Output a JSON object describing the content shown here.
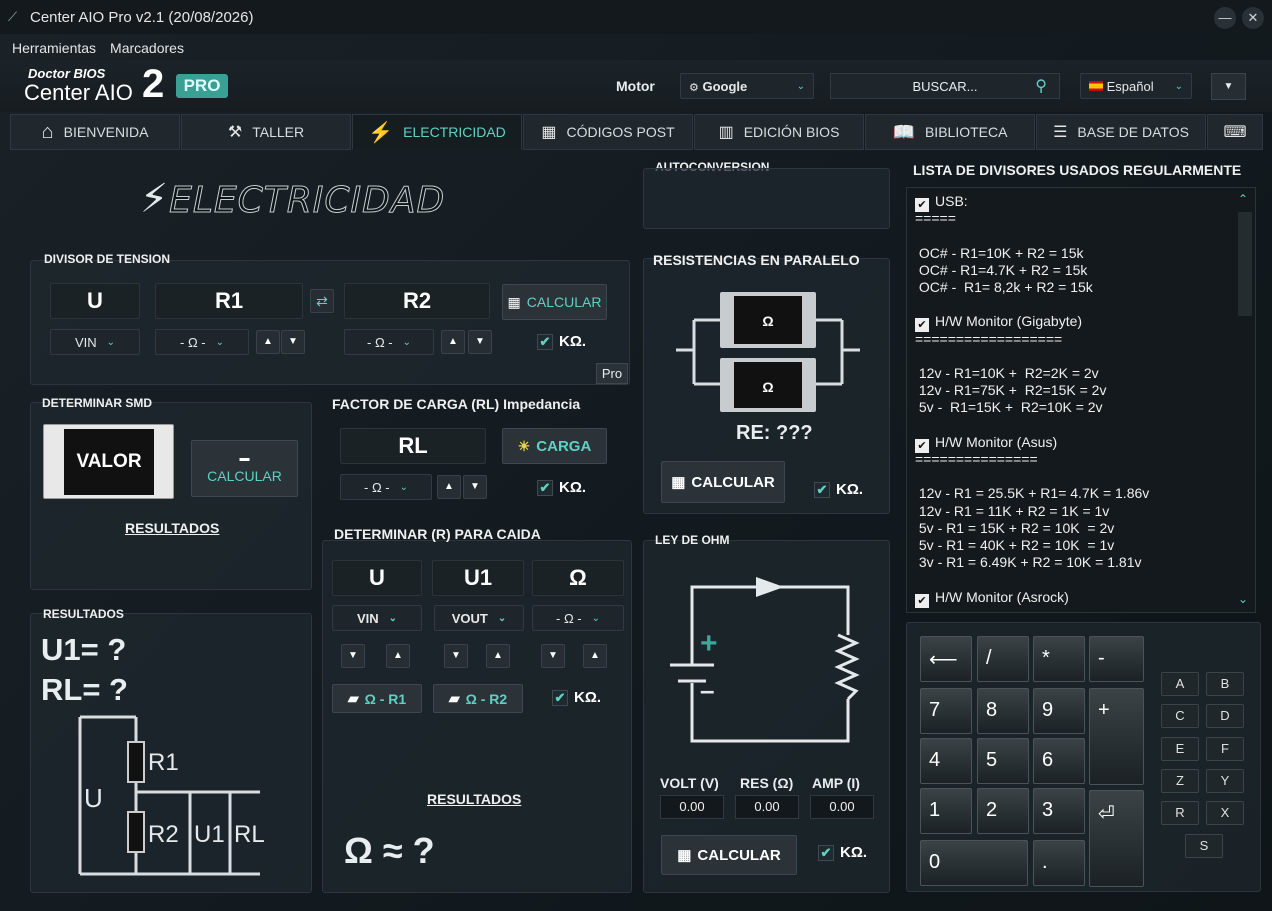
{
  "window": {
    "title": "Center AIO Pro v2.1 (20/08/2026)",
    "minimize": "—",
    "close": "✕"
  },
  "menu": [
    "Herramientas",
    "Marcadores"
  ],
  "logo": {
    "line1": "Doctor BIOS",
    "line2": "Center AIO",
    "number": "2",
    "badge": "PRO"
  },
  "search": {
    "engine_label": "Motor",
    "engine": "Google",
    "placeholder": "BUSCAR...",
    "language": "Español"
  },
  "tabs": [
    {
      "label": "BIENVENIDA",
      "icon": "home-icon"
    },
    {
      "label": "TALLER",
      "icon": "tools-icon"
    },
    {
      "label": "ELECTRICIDAD",
      "icon": "lightning-icon"
    },
    {
      "label": "CÓDIGOS POST",
      "icon": "post-card-icon"
    },
    {
      "label": "EDICIÓN BIOS",
      "icon": "chip-icon"
    },
    {
      "label": "BIBLIOTECA",
      "icon": "book-icon"
    },
    {
      "label": "BASE DE DATOS",
      "icon": "database-icon"
    }
  ],
  "section_banner": "ELECTRICIDAD",
  "divisor": {
    "title": "DIVISOR DE TENSION",
    "u": "U",
    "r1": "R1",
    "r2": "R2",
    "calc": "CALCULAR",
    "vin": "VIN",
    "ohm": "- Ω -",
    "kohm": "KΩ.",
    "pro": "Pro"
  },
  "smd": {
    "title": "DETERMINAR SMD",
    "value": "VALOR",
    "calc": "CALCULAR",
    "results": "RESULTADOS"
  },
  "results_left": {
    "title": "RESULTADOS",
    "u1": "U1= ?",
    "rl": "RL= ?",
    "labels": {
      "u": "U",
      "r1": "R1",
      "r2": "R2",
      "u1": "U1",
      "rl": "RL"
    }
  },
  "carga": {
    "title": "FACTOR DE CARGA (RL) Impedancia",
    "rl": "RL",
    "btn": "CARGA",
    "ohm": "- Ω -",
    "kohm": "KΩ."
  },
  "caida": {
    "title": "DETERMINAR (R) PARA CAIDA",
    "u": "U",
    "u1": "U1",
    "omega": "Ω",
    "vin": "VIN",
    "vout": "VOUT",
    "ohm": "- Ω -",
    "b1": "Ω - R1",
    "b2": "Ω - R2",
    "kohm": "KΩ.",
    "results": "RESULTADOS",
    "answer": "Ω ≈ ?"
  },
  "auto": {
    "title": "AUTOCONVERSION"
  },
  "paralelo": {
    "title": "RESISTENCIAS EN PARALELO",
    "omega": "Ω",
    "re": "RE: ???",
    "calc": "CALCULAR",
    "kohm": "KΩ."
  },
  "ohm": {
    "title": "LEY DE OHM",
    "plus": "+",
    "minus": "–",
    "volt": "VOLT (V)",
    "res": "RES (Ω)",
    "amp": "AMP (I)",
    "volt_val": "0.00",
    "res_val": "0.00",
    "amp_val": "0.00",
    "calc": "CALCULAR",
    "kohm": "KΩ."
  },
  "divisores": {
    "title": "LISTA DE DIVISORES USADOS REGULARMENTE",
    "lines": [
      {
        "t": "USB:",
        "chk": true
      },
      {
        "t": "====="
      },
      {
        "t": ""
      },
      {
        "t": " OC# - R1=10K + R2 = 15k"
      },
      {
        "t": " OC# - R1=4.7K + R2 = 15k"
      },
      {
        "t": " OC# -  R1= 8,2k + R2 = 15k"
      },
      {
        "t": ""
      },
      {
        "t": "H/W Monitor (Gigabyte)",
        "chk": true
      },
      {
        "t": "=================="
      },
      {
        "t": ""
      },
      {
        "t": " 12v - R1=10K +  R2=2K = 2v"
      },
      {
        "t": " 12v - R1=75K +  R2=15K = 2v"
      },
      {
        "t": " 5v -  R1=15K +  R2=10K = 2v"
      },
      {
        "t": ""
      },
      {
        "t": "H/W Monitor (Asus)",
        "chk": true
      },
      {
        "t": "==============="
      },
      {
        "t": ""
      },
      {
        "t": " 12v - R1 = 25.5K + R1= 4.7K = 1.86v"
      },
      {
        "t": " 12v - R1 = 11K + R2 = 1K = 1v"
      },
      {
        "t": " 5v - R1 = 15K + R2 = 10K  = 2v"
      },
      {
        "t": " 5v - R1 = 40K + R2 = 10K  = 1v"
      },
      {
        "t": " 3v - R1 = 6.49K + R2 = 10K = 1.81v"
      },
      {
        "t": ""
      },
      {
        "t": "H/W Monitor (Asrock)",
        "chk": true
      },
      {
        "t": "================"
      }
    ]
  },
  "keypad": {
    "keys": [
      "⟵",
      "/",
      "*",
      "-",
      "7",
      "8",
      "9",
      "+",
      "4",
      "5",
      "6",
      "1",
      "2",
      "3",
      "⏎",
      "0",
      "."
    ],
    "letters": [
      "A",
      "B",
      "C",
      "D",
      "E",
      "F",
      "Z",
      "Y",
      "R",
      "X",
      "S"
    ]
  }
}
